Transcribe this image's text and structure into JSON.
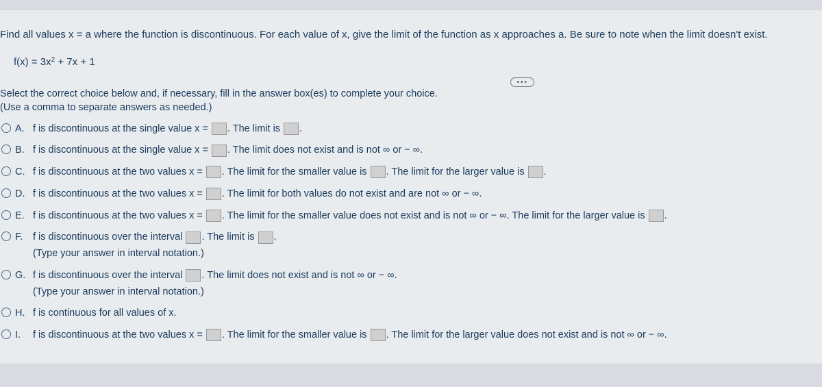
{
  "question": "Find all values x = a where the function is discontinuous. For each value of x, give the limit of the function as x approaches a. Be sure to note when the limit doesn't exist.",
  "formula_prefix": "f(x) = 3x",
  "formula_exp": "2",
  "formula_suffix": " + 7x + 1",
  "ellipsis": "•••",
  "instruction_line1": "Select the correct choice below and, if necessary, fill in the answer box(es) to complete your choice.",
  "instruction_line2": "(Use a comma to separate answers as needed.)",
  "options": {
    "A": {
      "label": "A.",
      "t1": "f is discontinuous at the single value x = ",
      "t2": ". The limit is ",
      "t3": "."
    },
    "B": {
      "label": "B.",
      "t1": "f is discontinuous at the single value x = ",
      "t2": ". The limit does not exist and is not ∞ or − ∞."
    },
    "C": {
      "label": "C.",
      "t1": "f is discontinuous at the two values x = ",
      "t2": ". The limit for the smaller value is ",
      "t3": ". The limit for the larger value is ",
      "t4": "."
    },
    "D": {
      "label": "D.",
      "t1": "f is discontinuous at the two values x = ",
      "t2": ". The limit for both values do not exist and are not ∞ or − ∞."
    },
    "E": {
      "label": "E.",
      "t1": "f is discontinuous at the two values x = ",
      "t2": ". The limit for the smaller value does not exist and is not ∞ or − ∞. The limit for the larger value is ",
      "t3": "."
    },
    "F": {
      "label": "F.",
      "t1": "f is discontinuous over the interval ",
      "t2": ". The limit is ",
      "t3": ".",
      "hint": "(Type your answer in interval notation.)"
    },
    "G": {
      "label": "G.",
      "t1": "f is discontinuous over the interval ",
      "t2": ". The limit does not exist and is not ∞ or − ∞.",
      "hint": "(Type your answer in interval notation.)"
    },
    "H": {
      "label": "H.",
      "t1": "f is continuous for all values of x."
    },
    "I": {
      "label": "I.",
      "t1": "f is discontinuous at the two values x = ",
      "t2": ". The limit for the smaller value is ",
      "t3": ". The limit for the larger value does not exist and is not ∞ or − ∞."
    }
  }
}
